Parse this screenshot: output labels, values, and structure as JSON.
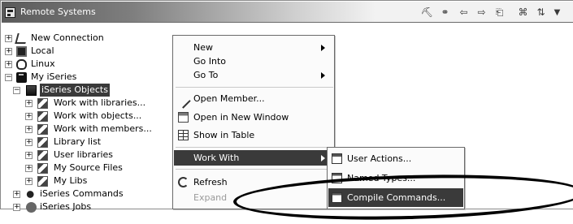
{
  "title": "Remote Systems",
  "tree": {
    "rows": [
      {
        "label": "New Connection",
        "expander": "+",
        "icon": "new-connection-icon"
      },
      {
        "label": "Local",
        "expander": "+",
        "icon": "local-system-icon"
      },
      {
        "label": "Linux",
        "expander": "+",
        "icon": "linux-icon"
      },
      {
        "label": "My iSeries",
        "expander": "−",
        "icon": "iseries-system-icon"
      },
      {
        "label": "iSeries Objects",
        "expander": "−",
        "icon": "iseries-objects-icon",
        "selected": true
      },
      {
        "label": "Work with libraries...",
        "expander": "+",
        "icon": "filter-icon"
      },
      {
        "label": "Work with objects...",
        "expander": "+",
        "icon": "filter-icon"
      },
      {
        "label": "Work with members...",
        "expander": "+",
        "icon": "filter-icon"
      },
      {
        "label": "Library list",
        "expander": "+",
        "icon": "library-icon"
      },
      {
        "label": "User libraries",
        "expander": "+",
        "icon": "library-icon"
      },
      {
        "label": "My Source Files",
        "expander": "+",
        "icon": "library-icon"
      },
      {
        "label": "My Libs",
        "expander": "+",
        "icon": "library-icon"
      },
      {
        "label": "iSeries Commands",
        "expander": "+",
        "icon": "iseries-commands-icon"
      },
      {
        "label": "iSeries Jobs",
        "expander": "+",
        "icon": "iseries-jobs-icon"
      }
    ]
  },
  "context_menu": {
    "items": [
      {
        "label": "New",
        "submenu": true
      },
      {
        "label": "Go Into",
        "submenu": false
      },
      {
        "label": "Go To",
        "submenu": true
      },
      {
        "label": "Open Member...",
        "icon": "pencil-icon"
      },
      {
        "label": "Open in New Window",
        "icon": "open-window-icon"
      },
      {
        "label": "Show in Table",
        "icon": "table-icon"
      },
      {
        "label": "Work With",
        "submenu": true,
        "highlighted": true
      },
      {
        "label": "Refresh",
        "icon": "refresh-icon"
      },
      {
        "label": "Expand",
        "disabled": true
      }
    ]
  },
  "submenu": {
    "items": [
      {
        "label": "User Actions...",
        "icon": "user-actions-icon"
      },
      {
        "label": "Named Types...",
        "icon": "named-types-icon"
      },
      {
        "label": "Compile Commands...",
        "icon": "compile-commands-icon",
        "highlighted": true
      }
    ]
  },
  "colors": {
    "selection": "#3a3a3a",
    "annotation": "#000000"
  }
}
